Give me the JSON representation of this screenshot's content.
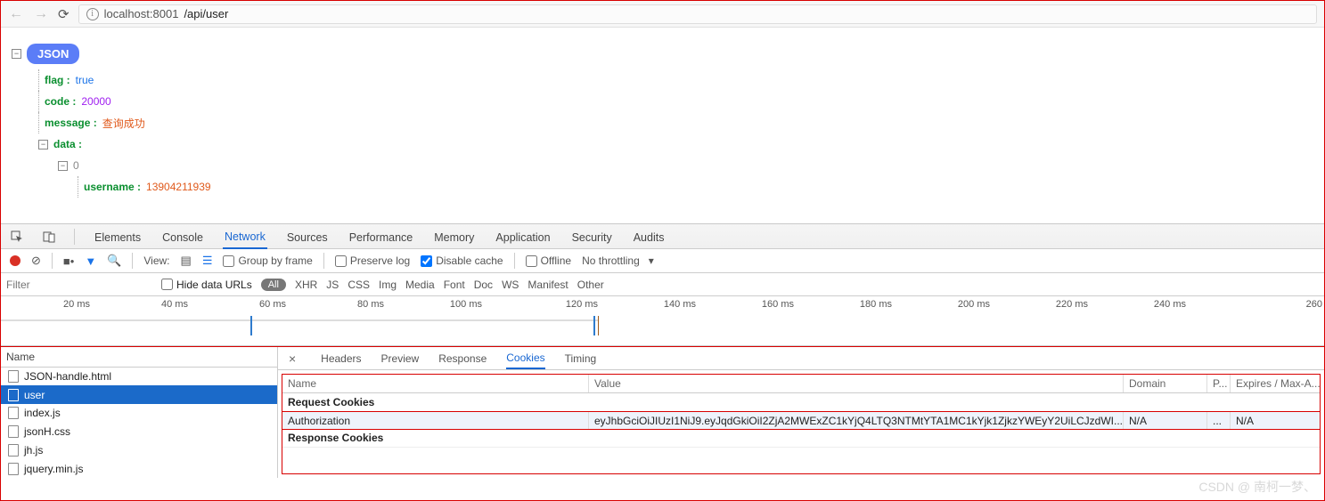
{
  "browser": {
    "url_host": "localhost",
    "url_port": ":8001",
    "url_path": "/api/user"
  },
  "json_view": {
    "root_label": "JSON",
    "flag_key": "flag :",
    "flag_val": "true",
    "code_key": "code :",
    "code_val": "20000",
    "message_key": "message :",
    "message_val": "查询成功",
    "data_key": "data :",
    "idx0": "0",
    "username_key": "username :",
    "username_val": "13904211939"
  },
  "devtools": {
    "tabs": [
      "Elements",
      "Console",
      "Network",
      "Sources",
      "Performance",
      "Memory",
      "Application",
      "Security",
      "Audits"
    ],
    "active_tab": "Network",
    "toolbar": {
      "view_label": "View:",
      "group_label": "Group by frame",
      "preserve_label": "Preserve log",
      "disable_cache_label": "Disable cache",
      "offline_label": "Offline",
      "throttle_label": "No throttling"
    },
    "filter": {
      "placeholder": "Filter",
      "hide_urls_label": "Hide data URLs",
      "pill": "All",
      "types": [
        "XHR",
        "JS",
        "CSS",
        "Img",
        "Media",
        "Font",
        "Doc",
        "WS",
        "Manifest",
        "Other"
      ]
    },
    "timeline_ticks": [
      "20 ms",
      "40 ms",
      "60 ms",
      "80 ms",
      "100 ms",
      "120 ms",
      "140 ms",
      "160 ms",
      "180 ms",
      "200 ms",
      "220 ms",
      "240 ms",
      "260"
    ]
  },
  "requests": {
    "header": "Name",
    "items": [
      "JSON-handle.html",
      "user",
      "index.js",
      "jsonH.css",
      "jh.js",
      "jquery.min.js"
    ],
    "selected": "user"
  },
  "detail": {
    "tabs": [
      "Headers",
      "Preview",
      "Response",
      "Cookies",
      "Timing"
    ],
    "active": "Cookies",
    "cookie_table": {
      "cols": {
        "name": "Name",
        "value": "Value",
        "domain": "Domain",
        "p": "P...",
        "expires": "Expires / Max-A..."
      },
      "req_section": "Request Cookies",
      "res_section": "Response Cookies",
      "row": {
        "name": "Authorization",
        "value": "eyJhbGciOiJIUzI1NiJ9.eyJqdGkiOiI2ZjA2MWExZC1kYjQ4LTQ3NTMtYTA1MC1kYjk1ZjkzYWEyY2UiLCJzdWI...",
        "domain": "N/A",
        "p": "...",
        "expires": "N/A"
      }
    }
  },
  "watermark": "CSDN @ 南柯一梦、"
}
